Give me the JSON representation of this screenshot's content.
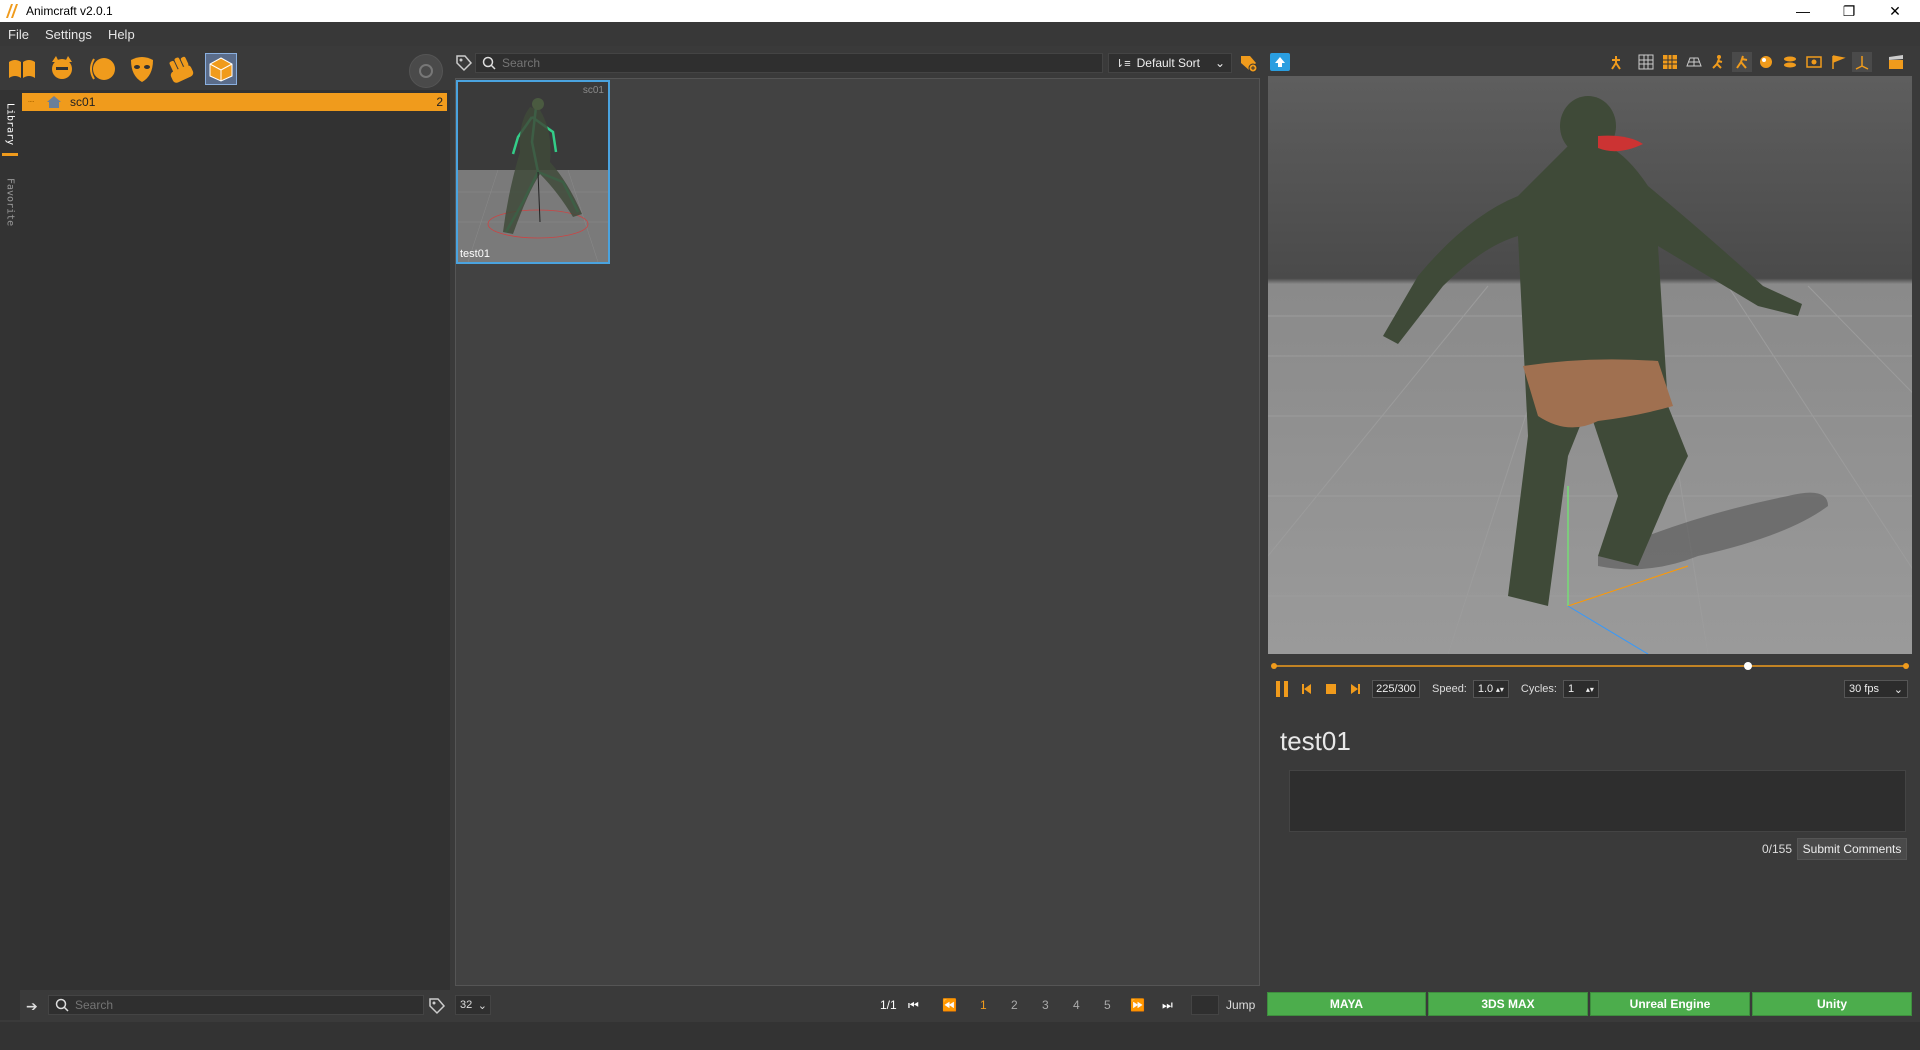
{
  "window": {
    "title": "Animcraft v2.0.1",
    "minimize": "—",
    "restore": "❐",
    "close": "✕"
  },
  "menu": {
    "items": [
      "File",
      "Settings",
      "Help"
    ]
  },
  "colors": {
    "accent": "#f09b1c",
    "export_green": "#4cad4c",
    "selection_blue": "#4aa3df"
  },
  "toolbar_icons": [
    "library-book-icon",
    "character-head-icon",
    "sphere-icon",
    "mask-icon",
    "hand-gesture-icon",
    "grid-cube-icon"
  ],
  "left_tabs": {
    "library": "Library",
    "favorite": "Favorite"
  },
  "tree": {
    "root": {
      "label": "sc01",
      "count": "2"
    }
  },
  "search": {
    "placeholder": "Search"
  },
  "sort": {
    "selected": "Default Sort"
  },
  "thumbnail": {
    "name": "test01",
    "category": "sc01"
  },
  "playback": {
    "frame": "225/300",
    "speed_label": "Speed:",
    "speed": "1.0",
    "cycles_label": "Cycles:",
    "cycles": "1",
    "fps": "30 fps",
    "progress": 0.75
  },
  "asset": {
    "name": "test01",
    "char_count": "0/155",
    "submit_label": "Submit Comments"
  },
  "export": {
    "maya": "MAYA",
    "max": "3DS MAX",
    "unreal": "Unreal Engine",
    "unity": "Unity"
  },
  "bottom": {
    "search_placeholder": "Search",
    "page_size": "32",
    "page_info": "1/1",
    "pages": [
      "1",
      "2",
      "3",
      "4",
      "5"
    ],
    "jump_label": "Jump"
  }
}
